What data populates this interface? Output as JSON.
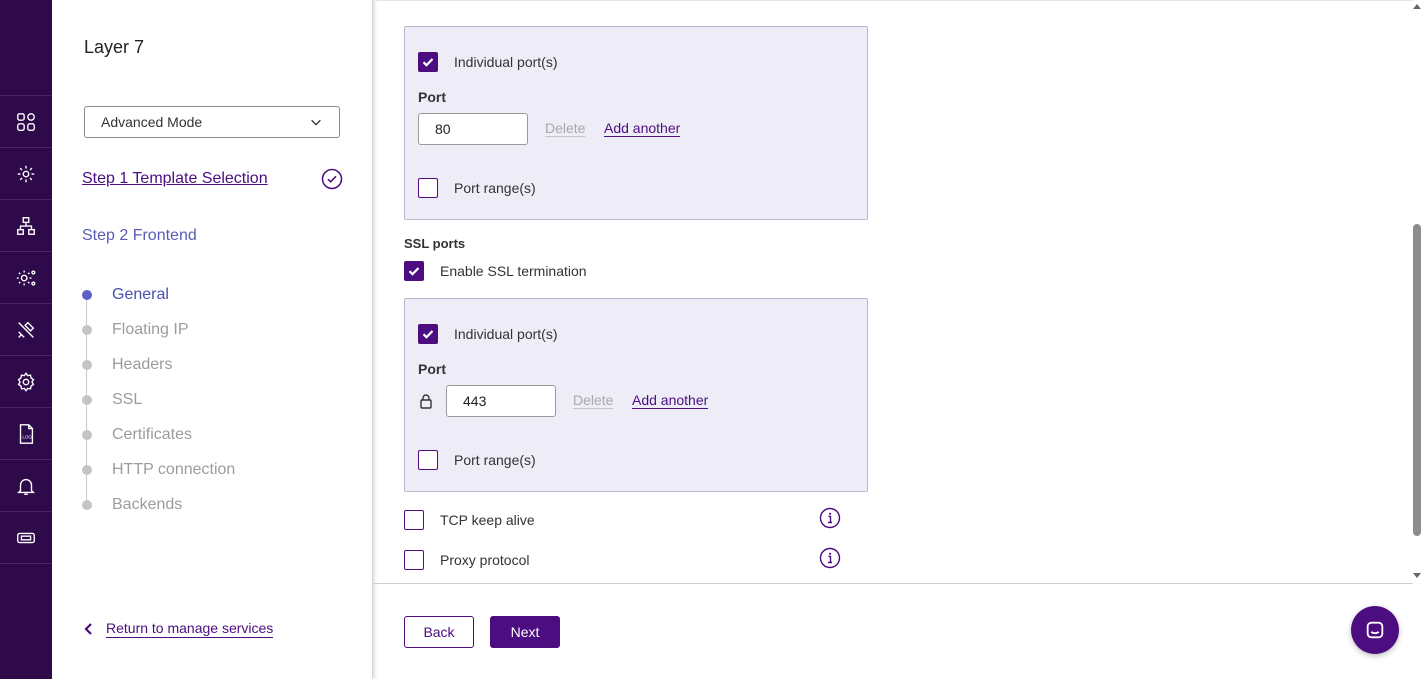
{
  "sidebar": {
    "title": "Layer 7",
    "mode_select": "Advanced Mode",
    "step1_label": "Step 1 Template Selection",
    "step2_label": "Step 2 Frontend",
    "substeps": [
      {
        "label": "General",
        "active": true
      },
      {
        "label": "Floating IP",
        "active": false
      },
      {
        "label": "Headers",
        "active": false
      },
      {
        "label": "SSL",
        "active": false
      },
      {
        "label": "Certificates",
        "active": false
      },
      {
        "label": "HTTP connection",
        "active": false
      },
      {
        "label": "Backends",
        "active": false
      }
    ],
    "return_label": "Return to manage services"
  },
  "rail_icons": [
    "dashboard-icon",
    "services-icon",
    "network-icon",
    "settings-advanced-icon",
    "tools-icon",
    "gear-icon",
    "log-icon",
    "bell-icon",
    "ticket-icon"
  ],
  "http_ports": {
    "individual_label": "Individual port(s)",
    "individual_checked": true,
    "port_label": "Port",
    "port_value": "80",
    "delete_label": "Delete",
    "add_label": "Add another",
    "range_label": "Port range(s)",
    "range_checked": false
  },
  "ssl_ports": {
    "title": "SSL ports",
    "enable_label": "Enable SSL termination",
    "enable_checked": true,
    "individual_label": "Individual port(s)",
    "individual_checked": true,
    "port_label": "Port",
    "port_value": "443",
    "delete_label": "Delete",
    "add_label": "Add another",
    "range_label": "Port range(s)",
    "range_checked": false
  },
  "options": {
    "tcp_keepalive_label": "TCP keep alive",
    "proxy_protocol_label": "Proxy protocol"
  },
  "footer": {
    "back_label": "Back",
    "next_label": "Next"
  },
  "colors": {
    "rail_bg": "#2e0a4a",
    "accent": "#4b0d80",
    "active_step": "#5b5fc7",
    "panel_bg": "#eeedf7"
  }
}
